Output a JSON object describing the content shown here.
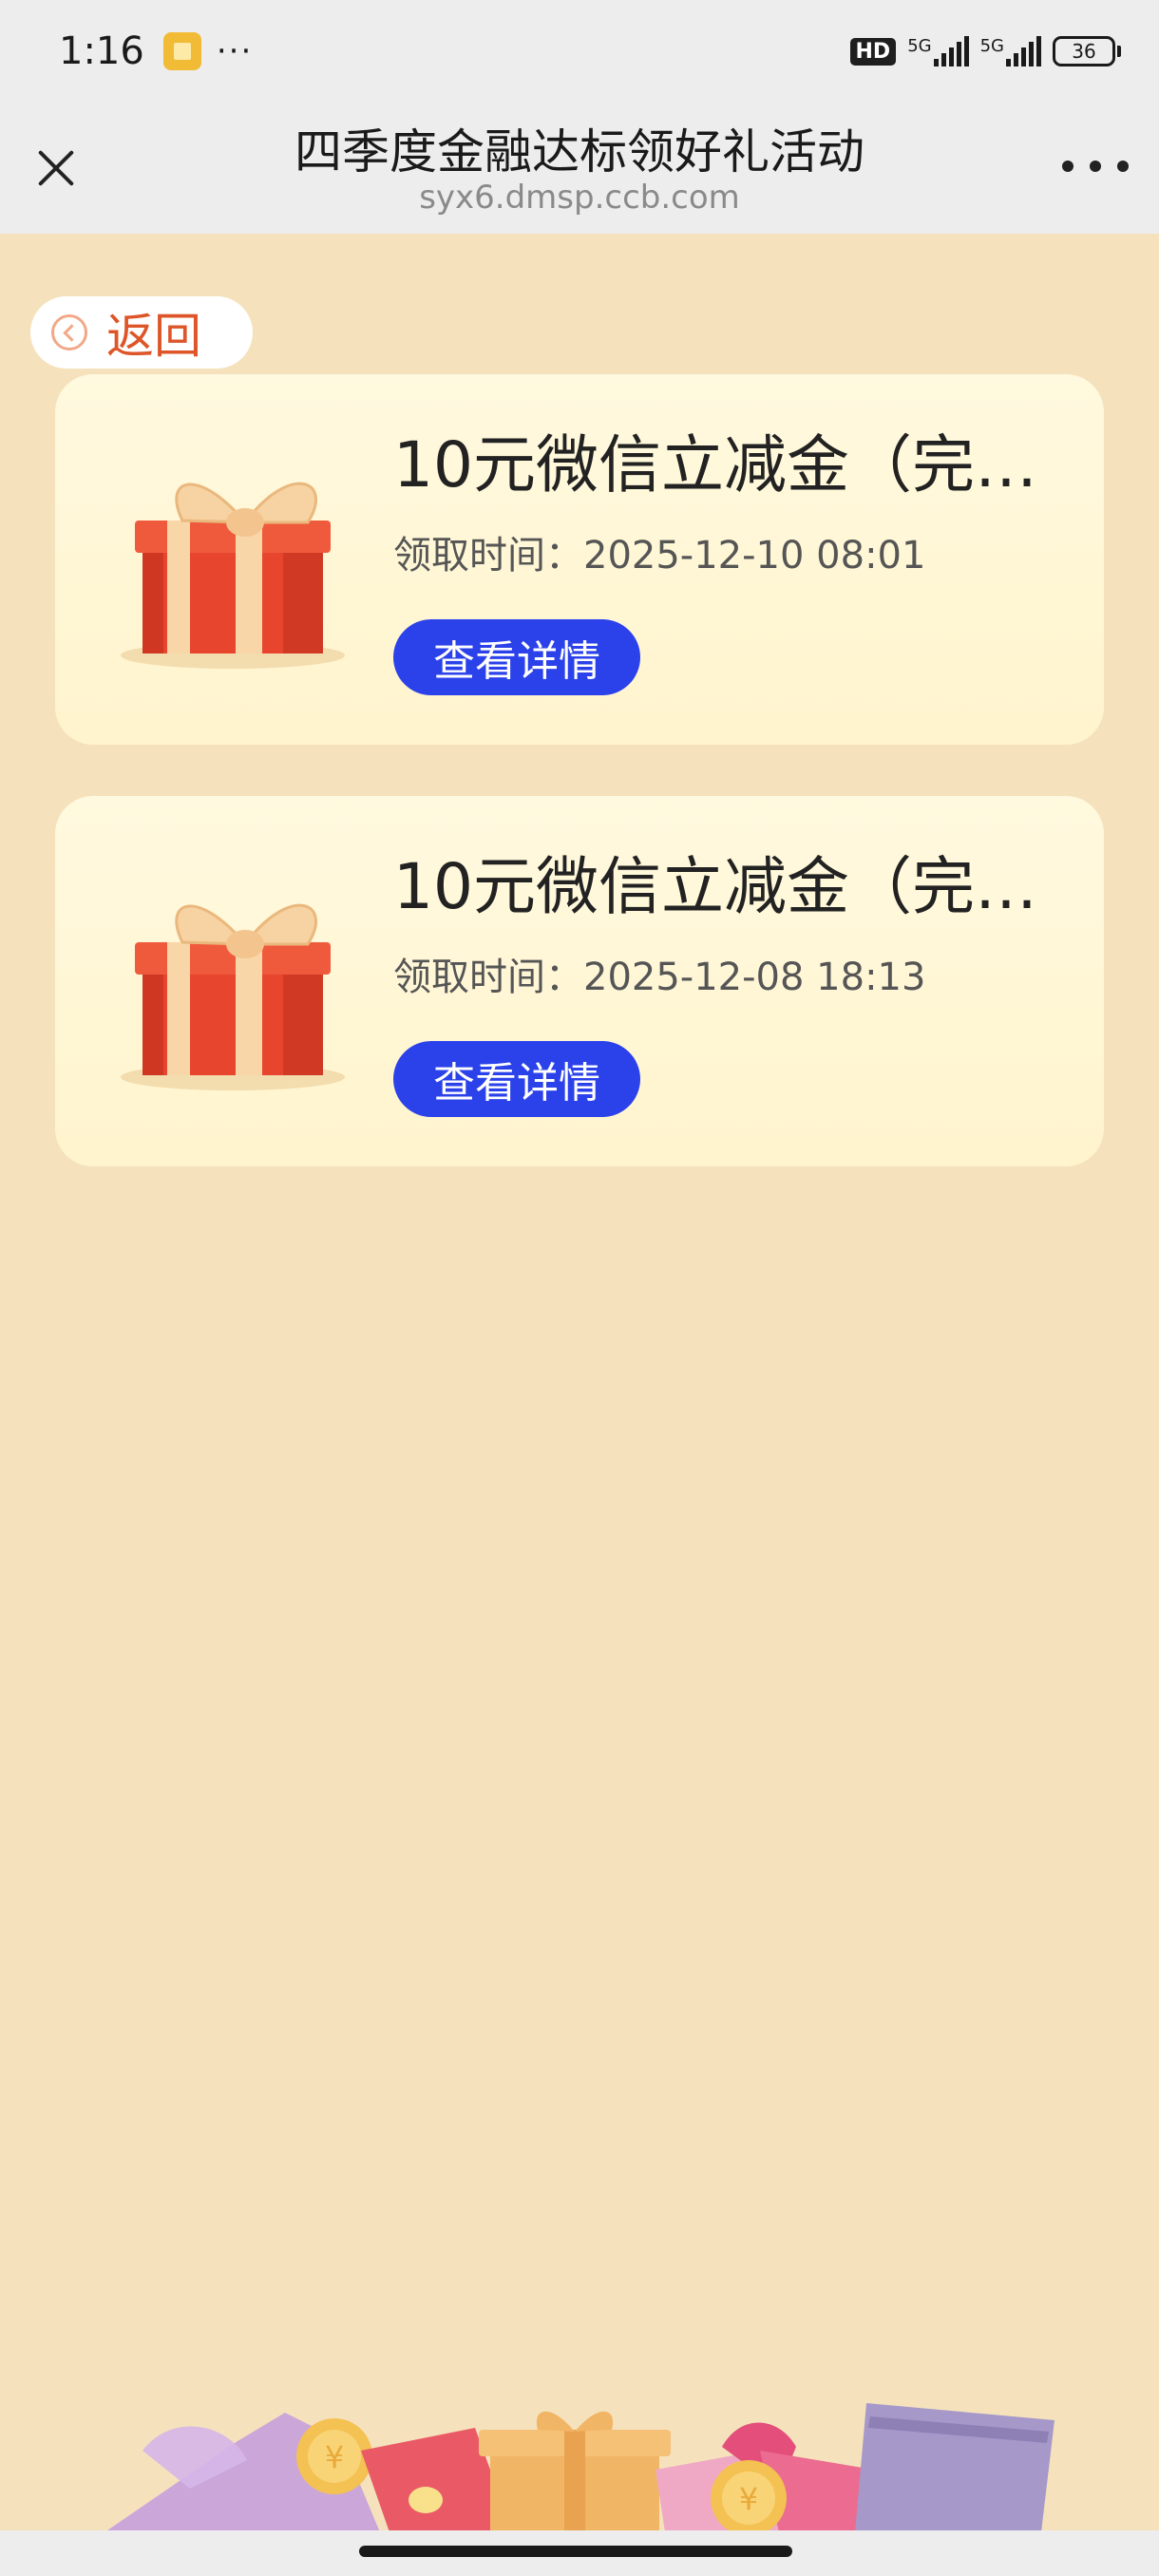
{
  "status_bar": {
    "time": "1:16",
    "more": "···",
    "hd": "HD",
    "network_1": "5G",
    "network_2": "5G",
    "battery": "36"
  },
  "title_bar": {
    "title": "四季度金融达标领好礼活动",
    "url": "syx6.dmsp.ccb.com"
  },
  "back_button": {
    "label": "返回"
  },
  "gifts": [
    {
      "title": "10元微信立减金（完…",
      "time": "领取时间：2025-12-10 08:01",
      "button": "查看详情"
    },
    {
      "title": "10元微信立减金（完…",
      "time": "领取时间：2025-12-08 18:13",
      "button": "查看详情"
    }
  ],
  "colors": {
    "page_background": "#f5e2bd",
    "accent_button": "#2b41ea",
    "back_text": "#dd5528"
  }
}
